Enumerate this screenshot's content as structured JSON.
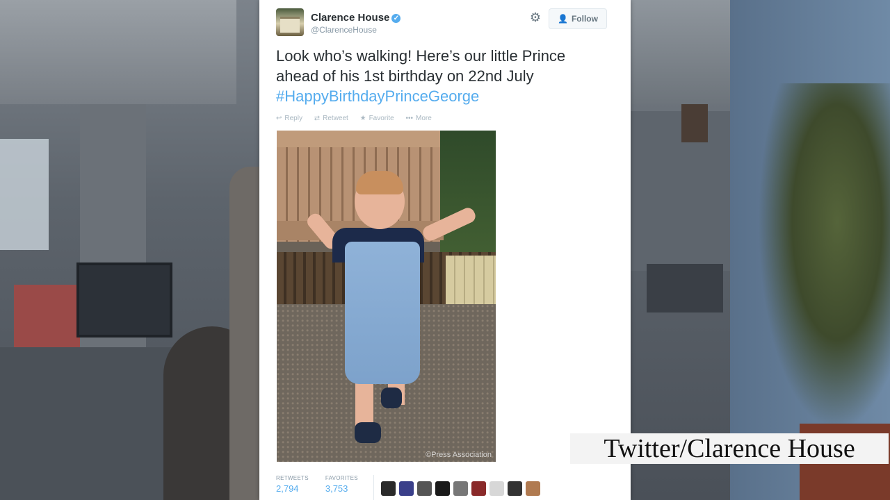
{
  "tweet": {
    "account_name": "Clarence House",
    "handle": "@ClarenceHouse",
    "follow_label": "Follow",
    "text_line1": "Look who’s walking! Here’s our little Prince",
    "text_line2": "ahead of his 1st birthday on 22nd July",
    "hashtag": "#HappyBirthdayPrinceGeorge",
    "actions": {
      "reply": "Reply",
      "retweet": "Retweet",
      "favorite": "Favorite",
      "more": "More"
    },
    "photo_credit": "©Press Association",
    "stats": {
      "retweets_label": "RETWEETS",
      "retweets_value": "2,794",
      "favorites_label": "FAVORITES",
      "favorites_value": "3,753"
    }
  },
  "caption": "Twitter/Clarence House",
  "colors": {
    "link_blue": "#55acee",
    "text_dark": "#292f33",
    "muted": "#8899a6"
  },
  "icons": [
    "verified-badge-icon",
    "gear-icon",
    "follow-person-icon",
    "reply-icon",
    "retweet-icon",
    "favorite-star-icon",
    "more-dots-icon"
  ]
}
